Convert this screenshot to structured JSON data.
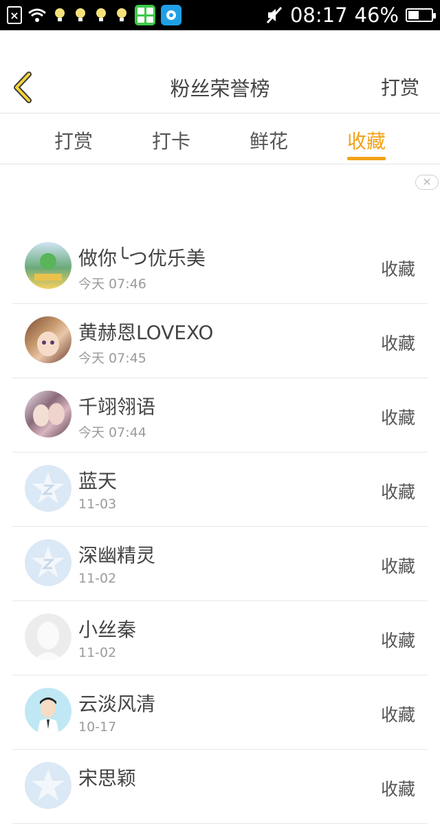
{
  "status_bar": {
    "time": "08:17",
    "battery_text": "46%",
    "battery_level": 0.46
  },
  "header": {
    "title": "粉丝荣誉榜",
    "right_label": "打赏"
  },
  "tabs": [
    {
      "label": "打赏",
      "active": false
    },
    {
      "label": "打卡",
      "active": false
    },
    {
      "label": "鲜花",
      "active": false
    },
    {
      "label": "收藏",
      "active": true
    }
  ],
  "fans": [
    {
      "name": "做你╰つ优乐美",
      "time": "今天 07:46",
      "action": "收藏",
      "avatar": "photo-avatar"
    },
    {
      "name": "黄赫恩LOVEXO",
      "time": "今天 07:45",
      "action": "收藏",
      "avatar": "anime-avatar"
    },
    {
      "name": "千翊翎语",
      "time": "今天 07:44",
      "action": "收藏",
      "avatar": "anime-avatar"
    },
    {
      "name": "蓝天",
      "time": "11-03",
      "action": "收藏",
      "avatar": "qzone-default-avatar"
    },
    {
      "name": "深幽精灵",
      "time": "11-02",
      "action": "收藏",
      "avatar": "qzone-default-avatar"
    },
    {
      "name": "小丝秦",
      "time": "11-02",
      "action": "收藏",
      "avatar": "silhouette-avatar"
    },
    {
      "name": "云淡风清",
      "time": "10-17",
      "action": "收藏",
      "avatar": "cartoon-boy-avatar"
    },
    {
      "name": "宋思颖",
      "time": "",
      "action": "收藏",
      "avatar": "qzone-default-avatar"
    }
  ],
  "colors": {
    "accent": "#f2a117",
    "status_bar_bg": "#000000",
    "divider": "#e6e6e6"
  }
}
